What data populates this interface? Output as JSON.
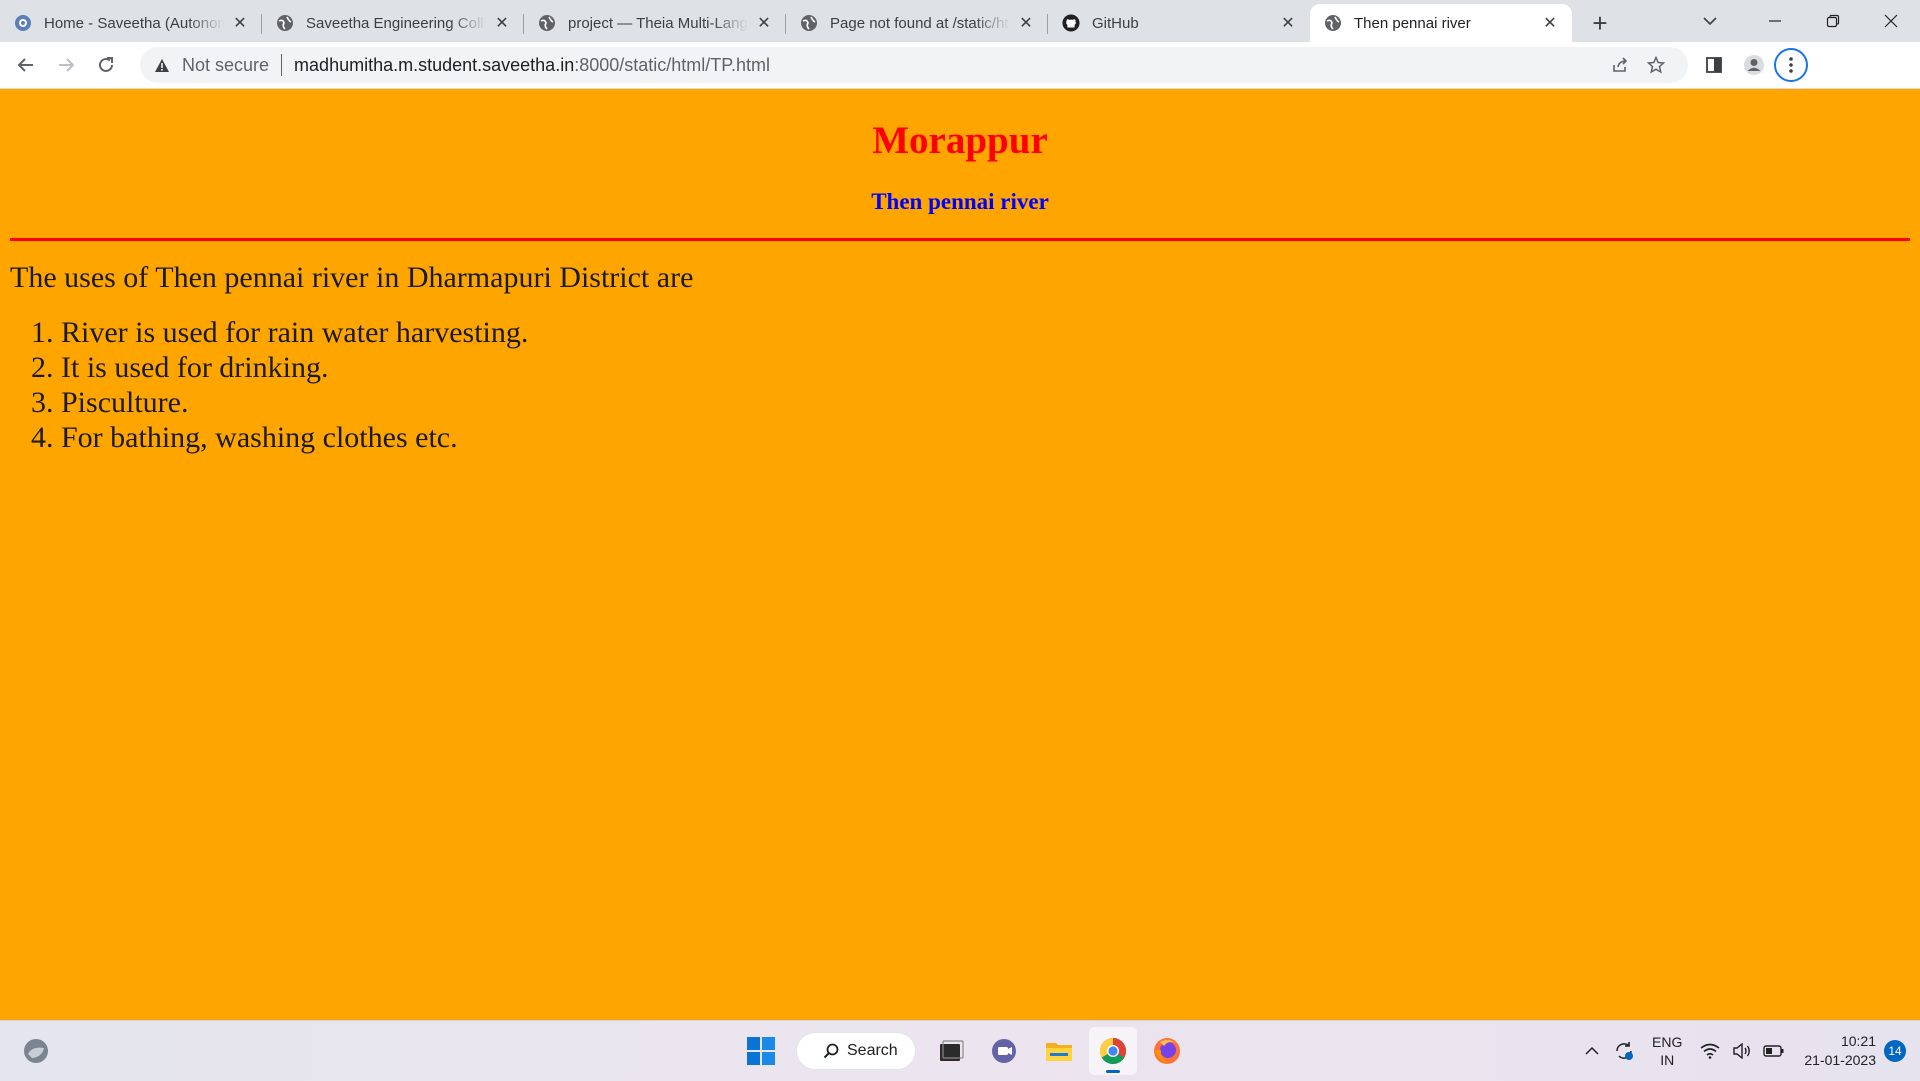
{
  "browser": {
    "tabs": [
      {
        "title": "Home - Saveetha (Autonomous)",
        "icon": "saveetha-favicon"
      },
      {
        "title": "Saveetha Engineering College",
        "icon": "globe-icon"
      },
      {
        "title": "project — Theia Multi-Language",
        "icon": "globe-icon"
      },
      {
        "title": "Page not found at /static/html",
        "icon": "globe-icon"
      },
      {
        "title": "GitHub",
        "icon": "github-icon"
      },
      {
        "title": "Then pennai river",
        "icon": "globe-icon"
      }
    ],
    "new_tab": "+",
    "omnibox": {
      "security_label": "Not secure",
      "host": "madhumitha.m.student.saveetha.in",
      "path": ":8000/static/html/TP.html"
    }
  },
  "page": {
    "heading": "Morappur",
    "subheading": "Then pennai river",
    "intro": "The uses of Then pennai river in Dharmapuri District are",
    "uses": [
      "River is used for rain water harvesting.",
      "It is used for drinking.",
      "Pisculture.",
      "For bathing, washing clothes etc."
    ],
    "colors": {
      "background": "#ffa500",
      "heading": "#ff0000",
      "subheading": "#0000ff",
      "rule": "#ff0000"
    }
  },
  "taskbar": {
    "search_label": "Search",
    "lang_line1": "ENG",
    "lang_line2": "IN",
    "time": "10:21",
    "date": "21-01-2023",
    "notification_count": "14"
  }
}
